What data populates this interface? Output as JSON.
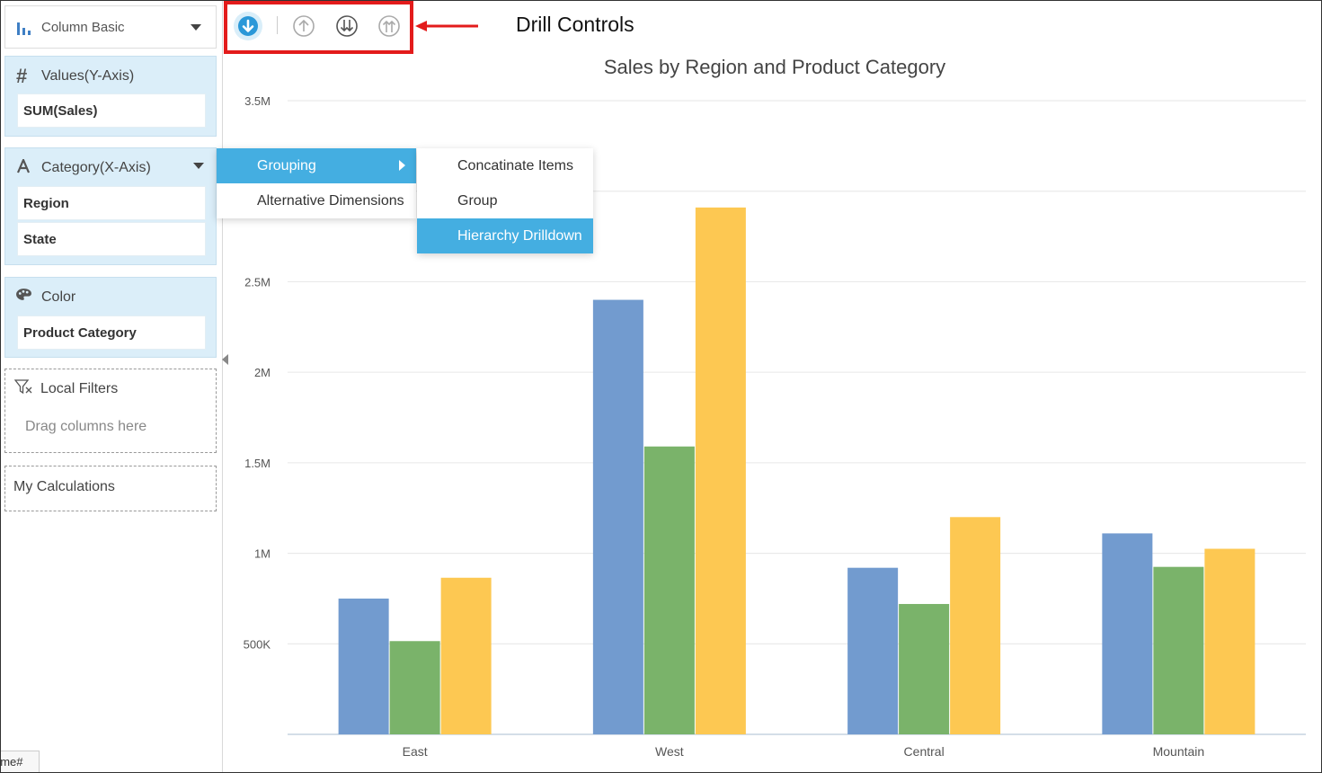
{
  "left_panel": {
    "chart_type": {
      "label": "Column Basic",
      "icon": "bar-chart-icon"
    },
    "values_section": {
      "title": "Values(Y-Axis)",
      "icon": "hash-icon",
      "items": [
        "SUM(Sales)"
      ]
    },
    "category_section": {
      "title": "Category(X-Axis)",
      "icon": "text-a-icon",
      "items": [
        "Region",
        "State"
      ]
    },
    "color_section": {
      "title": "Color",
      "icon": "palette-icon",
      "items": [
        "Product Category"
      ]
    },
    "local_filters": {
      "title": "Local Filters",
      "icon": "filter-icon",
      "placeholder": "Drag columns here"
    },
    "my_calculations": {
      "title": "My Calculations"
    },
    "status_tag": "ome#"
  },
  "drill_controls": {
    "annotation": "Drill Controls",
    "buttons": [
      {
        "name": "drill-down-icon",
        "active": true
      },
      {
        "name": "drill-up-icon",
        "active": false
      },
      {
        "name": "drill-down-all-icon",
        "active": false
      },
      {
        "name": "drill-up-all-icon",
        "active": false
      }
    ]
  },
  "context_menu": {
    "items": [
      "Grouping",
      "Alternative Dimensions"
    ],
    "active_item": "Grouping",
    "submenu": {
      "items": [
        "Concatinate Items",
        "Group",
        "Hierarchy Drilldown"
      ],
      "active_item": "Hierarchy Drilldown"
    }
  },
  "colors": {
    "accent": "#44aee1",
    "series1": "#729bcf",
    "series2": "#7ab36a",
    "series3": "#fdc852",
    "annotation": "#e31b1b"
  },
  "chart_data": {
    "type": "bar",
    "title": "Sales by Region and Product Category",
    "categories": [
      "East",
      "West",
      "Central",
      "Mountain"
    ],
    "series": [
      {
        "values": [
          750000,
          2400000,
          920000,
          1110000
        ]
      },
      {
        "values": [
          515000,
          1590000,
          720000,
          925000
        ]
      },
      {
        "values": [
          865000,
          2910000,
          1200000,
          1025000
        ]
      }
    ],
    "y_ticks": [
      "500K",
      "1M",
      "1.5M",
      "2M",
      "2.5M",
      "3.5M"
    ],
    "y_tick_values": [
      500000,
      1000000,
      1500000,
      2000000,
      2500000,
      3500000
    ],
    "ylim": [
      0,
      3500000
    ],
    "grid": true,
    "legend": "none"
  }
}
